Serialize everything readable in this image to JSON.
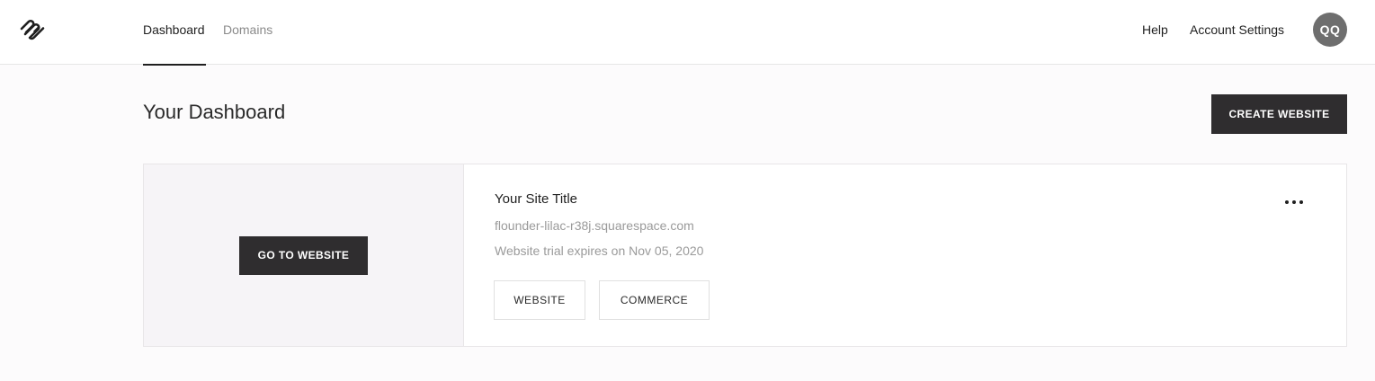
{
  "topbar": {
    "logo_icon": "squarespace-logo-icon",
    "tabs": [
      {
        "label": "Dashboard",
        "active": true
      },
      {
        "label": "Domains",
        "active": false
      }
    ],
    "help_label": "Help",
    "account_label": "Account Settings",
    "avatar_initials": "QQ"
  },
  "main": {
    "title": "Your Dashboard",
    "create_button_label": "CREATE WEBSITE"
  },
  "site_card": {
    "go_button_label": "GO TO WEBSITE",
    "title": "Your Site Title",
    "domain": "flounder-lilac-r38j.squarespace.com",
    "trial_text": "Website trial expires on Nov 05, 2020",
    "website_button_label": "WEBSITE",
    "commerce_button_label": "COMMERCE",
    "more_icon": "more-horizontal-icon"
  },
  "colors": {
    "dark_button": "#2f2d2f",
    "avatar_bg": "#6e6e6e",
    "muted_text": "#9a9a9a",
    "thumb_bg": "#f6f4f7"
  }
}
